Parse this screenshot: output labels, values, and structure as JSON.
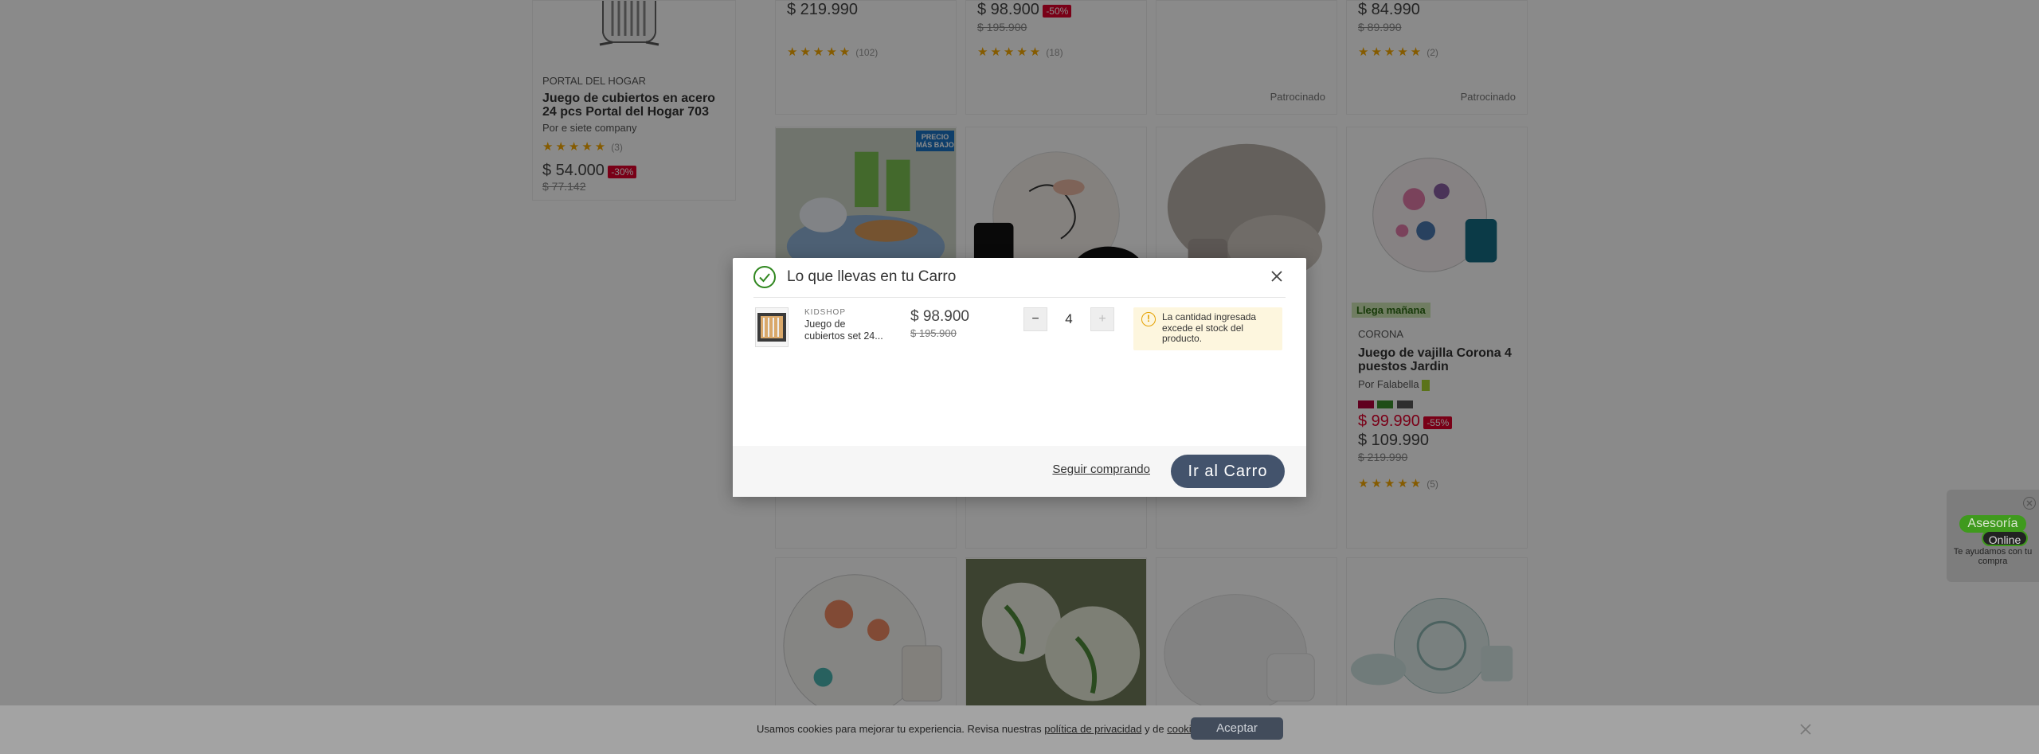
{
  "background": {
    "left_card": {
      "brand": "PORTAL DEL HOGAR",
      "name": "Juego de cubiertos en acero 24 pcs Portal del Hogar 703",
      "seller": "Por e siete company",
      "rating_count": "(3)",
      "price": "$ 54.000",
      "discount": "-30%",
      "old_price": "$ 77.142"
    },
    "row1": [
      {
        "price": "$ 219.990",
        "rating_count": "(102)"
      },
      {
        "price": "$ 98.900",
        "discount": "-50%",
        "old_price": "$ 195.900",
        "rating_count": "(18)"
      },
      {
        "sponsored": "Patrocinado"
      },
      {
        "price": "$ 84.990",
        "old_price": "$ 89.990",
        "rating_count": "(2)",
        "sponsored": "Patrocinado"
      }
    ],
    "badge_lowest": "PRECIO MÁS BAJO",
    "corona_card": {
      "arrives": "Llega mañana",
      "brand": "CORONA",
      "name": "Juego de vajilla Corona 4 puestos Jardin",
      "seller": "Por Falabella",
      "price_cmr": "$ 99.990",
      "discount": "-55%",
      "price": "$ 109.990",
      "old_price": "$ 219.990",
      "rating_count": "(5)"
    }
  },
  "modal": {
    "title": "Lo que llevas en tu Carro",
    "item": {
      "brand": "KIDSHOP",
      "name": "Juego de cubiertos set 24...",
      "price": "$ 98.900",
      "old_price": "$ 195.900",
      "quantity": "4",
      "minus": "−",
      "plus": "+"
    },
    "warning": {
      "icon": "!",
      "text": "La cantidad ingresada excede el stock del producto."
    },
    "continue_label": "Seguir comprando",
    "go_cart_label": "Ir al Carro"
  },
  "cookie": {
    "text_before": "Usamos cookies para mejorar tu experiencia. Revisa nuestras",
    "privacy_link": "política de privacidad",
    "conj": "y de",
    "cookies_link": "cookies",
    "period": ".",
    "accept_label": "Aceptar"
  },
  "chat": {
    "line1": "Asesoría",
    "line2": "Online",
    "sub": "Te ayudamos con tu compra"
  },
  "colors": {
    "overlay": "#000000",
    "primary_button": "#43536c",
    "success": "#30871f",
    "warning": "#e5a100",
    "discount": "#e0002c",
    "chat_green": "#3f9a1d"
  }
}
